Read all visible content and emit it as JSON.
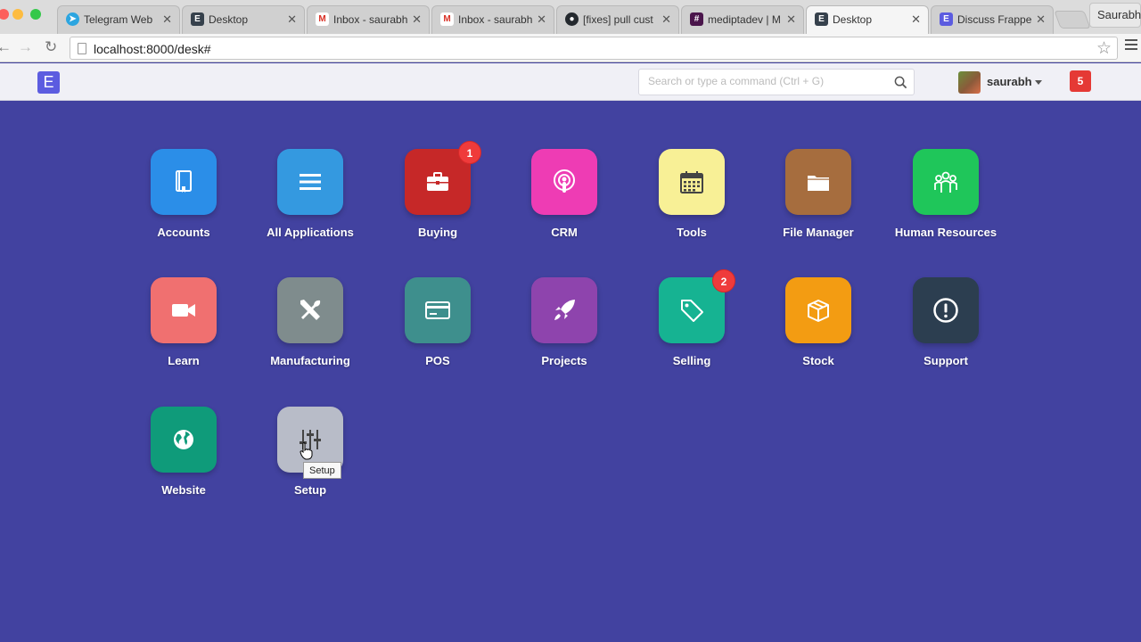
{
  "browser": {
    "tabs": [
      {
        "title": "Telegram Web",
        "icon": "telegram-icon",
        "color": "#2ca5e0",
        "active": false
      },
      {
        "title": "Desktop",
        "icon": "erpnext-icon",
        "color": "#36414c",
        "active": false
      },
      {
        "title": "Inbox - saurabh",
        "icon": "gmail-icon",
        "color": "#d93025",
        "active": false
      },
      {
        "title": "Inbox - saurabh",
        "icon": "gmail-icon",
        "color": "#d93025",
        "active": false
      },
      {
        "title": "[fixes] pull cust",
        "icon": "github-icon",
        "color": "#24292e",
        "active": false
      },
      {
        "title": "mediptadev | M",
        "icon": "slack-icon",
        "color": "#4a154b",
        "active": false
      },
      {
        "title": "Desktop",
        "icon": "erpnext-icon",
        "color": "#36414c",
        "active": true
      },
      {
        "title": "Discuss Frappe/",
        "icon": "discuss-icon",
        "color": "#5c5ce0",
        "active": false
      }
    ],
    "profile_name": "Saurabh",
    "url": "localhost:8000/desk#"
  },
  "navbar": {
    "logo_letter": "E",
    "search_placeholder": "Search or type a command (Ctrl + G)",
    "username": "saurabh",
    "notification_count": "5"
  },
  "apps": [
    {
      "label": "Accounts",
      "icon": "book-icon",
      "color": "#2b8ee8",
      "badge": ""
    },
    {
      "label": "All Applications",
      "icon": "list-icon",
      "color": "#3499e0",
      "badge": ""
    },
    {
      "label": "Buying",
      "icon": "briefcase-icon",
      "color": "#c62828",
      "badge": "1"
    },
    {
      "label": "CRM",
      "icon": "podcast-icon",
      "color": "#ee3cb4",
      "badge": ""
    },
    {
      "label": "Tools",
      "icon": "calendar-icon",
      "color": "#f8f096",
      "badge": ""
    },
    {
      "label": "File Manager",
      "icon": "folder-icon",
      "color": "#a66d3e",
      "badge": ""
    },
    {
      "label": "Human Resources",
      "icon": "users-icon",
      "color": "#1fc65a",
      "badge": ""
    },
    {
      "label": "Learn",
      "icon": "video-icon",
      "color": "#f07070",
      "badge": ""
    },
    {
      "label": "Manufacturing",
      "icon": "tools-icon",
      "color": "#7f8c8d",
      "badge": ""
    },
    {
      "label": "POS",
      "icon": "credit-card-icon",
      "color": "#3e8f8d",
      "badge": ""
    },
    {
      "label": "Projects",
      "icon": "rocket-icon",
      "color": "#8e44ad",
      "badge": ""
    },
    {
      "label": "Selling",
      "icon": "tag-icon",
      "color": "#16b392",
      "badge": "2"
    },
    {
      "label": "Stock",
      "icon": "box-icon",
      "color": "#f39c12",
      "badge": ""
    },
    {
      "label": "Support",
      "icon": "alert-icon",
      "color": "#2c3e50",
      "badge": ""
    },
    {
      "label": "Website",
      "icon": "globe-icon",
      "color": "#0f9b7a",
      "badge": ""
    },
    {
      "label": "Setup",
      "icon": "sliders-icon",
      "color": "#b8bcc8",
      "badge": ""
    }
  ],
  "tooltip": "Setup"
}
